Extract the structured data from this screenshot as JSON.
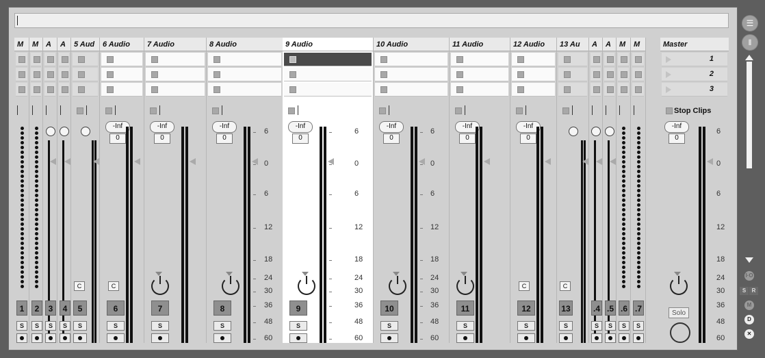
{
  "tracks": [
    {
      "title": "M",
      "number": "1",
      "solo": "S",
      "type": "midi"
    },
    {
      "title": "M",
      "number": "2",
      "solo": "S",
      "type": "midi"
    },
    {
      "title": "A",
      "number": "3",
      "solo": "S",
      "type": "audio-folded"
    },
    {
      "title": "A",
      "number": "4",
      "solo": "S",
      "type": "audio-folded"
    },
    {
      "title": "5 Aud",
      "number": "5",
      "solo": "S",
      "type": "audio-narrow"
    },
    {
      "title": "6 Audio",
      "number": "6",
      "solo": "S",
      "vol": "-Inf",
      "pan": "0",
      "type": "audio"
    },
    {
      "title": "7 Audio",
      "number": "7",
      "solo": "S",
      "vol": "-Inf",
      "pan": "0",
      "type": "audio"
    },
    {
      "title": "8 Audio",
      "number": "8",
      "solo": "S",
      "vol": "-Inf",
      "pan": "0",
      "type": "audio"
    },
    {
      "title": "9 Audio",
      "number": "9",
      "solo": "S",
      "vol": "-Inf",
      "pan": "0",
      "type": "audio"
    },
    {
      "title": "10 Audio",
      "number": "10",
      "solo": "S",
      "vol": "-Inf",
      "pan": "0",
      "type": "audio"
    },
    {
      "title": "11 Audio",
      "number": "11",
      "solo": "S",
      "vol": "-Inf",
      "pan": "0",
      "type": "audio"
    },
    {
      "title": "12 Audio",
      "number": "12",
      "solo": "S",
      "vol": "-Inf",
      "pan": "0",
      "type": "audio"
    },
    {
      "title": "13 Au",
      "number": "13",
      "solo": "S",
      "type": "audio-narrow"
    },
    {
      "title": "A",
      "number": ".4",
      "solo": "S",
      "type": "audio-folded"
    },
    {
      "title": "A",
      "number": ".5",
      "solo": "S",
      "type": "audio-folded"
    },
    {
      "title": "M",
      "number": ".6",
      "solo": "S",
      "type": "midi"
    },
    {
      "title": "M",
      "number": ".7",
      "solo": "S",
      "type": "midi"
    }
  ],
  "master": {
    "title": "Master",
    "scenes": [
      "1",
      "2",
      "3"
    ],
    "stop_clips": "Stop Clips",
    "vol": "-Inf",
    "pan": "0",
    "solo": "Solo"
  },
  "scale": [
    "6",
    "0",
    "6",
    "12",
    "18",
    "24",
    "30",
    "36",
    "48",
    "60"
  ],
  "cross_label": "C",
  "side": {
    "io": "I·O",
    "s": "S",
    "r": "R",
    "m": "M",
    "d": "D",
    "x": "✕"
  },
  "colors": {
    "background": "#d0d0d0",
    "selected_track": "#ffffff",
    "number_box": "#8f8f8f",
    "meter": "#111111"
  }
}
